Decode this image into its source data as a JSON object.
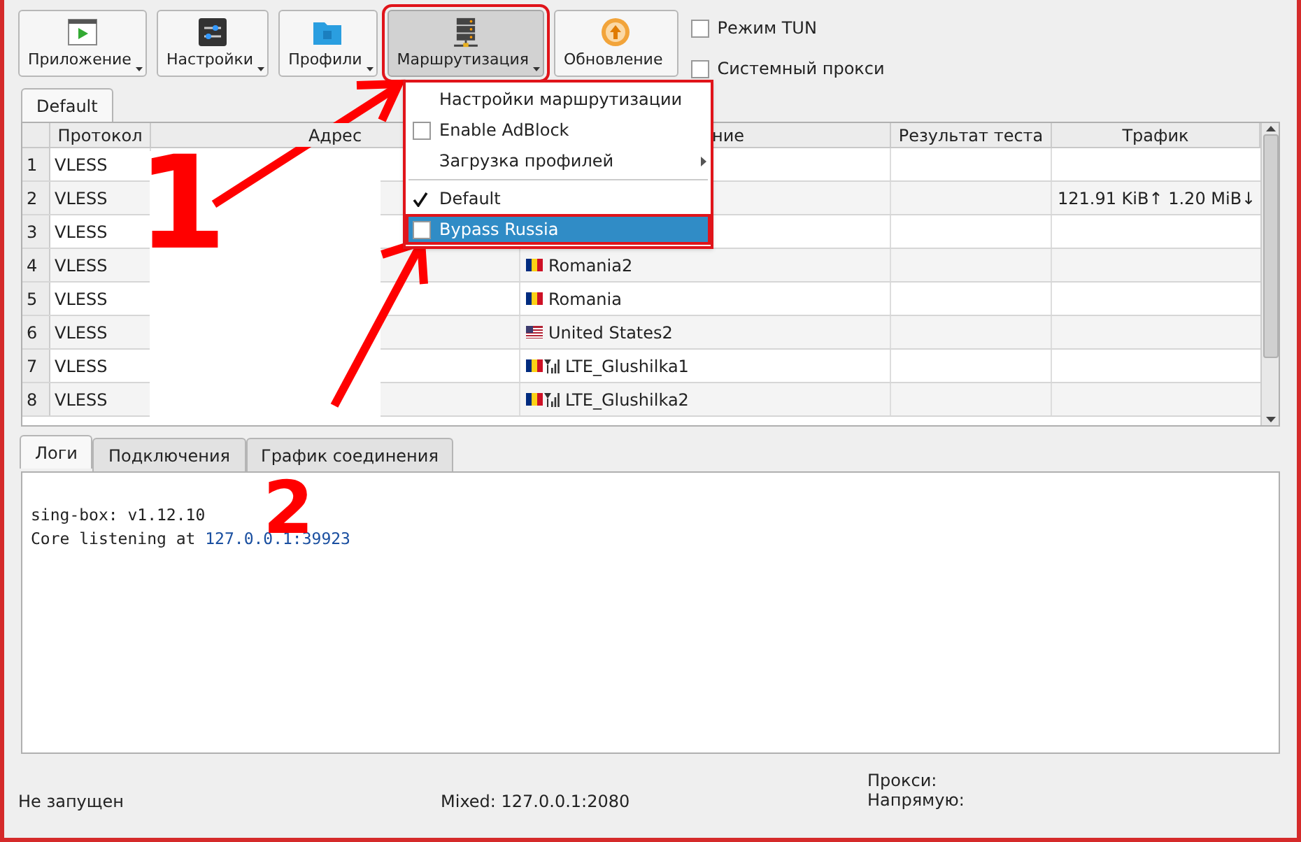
{
  "toolbar": {
    "buttons": [
      {
        "label": "Приложение",
        "kind": "app",
        "has_menu": true,
        "pressed": false
      },
      {
        "label": "Настройки",
        "kind": "settings",
        "has_menu": true,
        "pressed": false
      },
      {
        "label": "Профили",
        "kind": "profiles",
        "has_menu": true,
        "pressed": false
      },
      {
        "label": "Маршрутизация",
        "kind": "routing",
        "has_menu": true,
        "pressed": true
      },
      {
        "label": "Обновление",
        "kind": "update",
        "has_menu": false,
        "pressed": false
      }
    ],
    "checkboxes": [
      {
        "label": "Режим TUN",
        "checked": false
      },
      {
        "label": "Системный прокси",
        "checked": false
      }
    ]
  },
  "group_tabs": [
    {
      "label": "Default",
      "selected": true
    }
  ],
  "table": {
    "columns": [
      "Протокол",
      "Адрес",
      "ние",
      "Результат теста",
      "Трафик"
    ],
    "rows": [
      {
        "number": "1",
        "protocol": "VLESS",
        "kind": "plain"
      },
      {
        "number": "2",
        "protocol": "VLESS",
        "kind": "plain",
        "traffic": "121.91 KiB↑ 1.20 MiB↓"
      },
      {
        "number": "3",
        "protocol": "VLESS",
        "kind": "plain"
      },
      {
        "number": "4",
        "protocol": "VLESS",
        "name": "Romania2",
        "kind": "romania"
      },
      {
        "number": "5",
        "protocol": "VLESS",
        "name": "Romania",
        "kind": "romania"
      },
      {
        "number": "6",
        "protocol": "VLESS",
        "name": "United States2",
        "kind": "usa"
      },
      {
        "number": "7",
        "protocol": "VLESS",
        "name": "LTE_Glushilka1",
        "kind": "romania-lte"
      },
      {
        "number": "8",
        "protocol": "VLESS",
        "name": "LTE_Glushilka2",
        "kind": "romania-lte"
      }
    ]
  },
  "routing_menu": {
    "items": [
      {
        "kind": "action",
        "label": "Настройки маршрутизации",
        "selected": false
      },
      {
        "kind": "checkbox",
        "label": "Enable AdBlock",
        "checked": false,
        "selected": false
      },
      {
        "kind": "submenu",
        "label": "Загрузка профилей",
        "selected": false
      },
      {
        "kind": "separator"
      },
      {
        "kind": "checkbox",
        "label": "Default",
        "checked": true,
        "selected": false
      },
      {
        "kind": "checkbox",
        "label": "Bypass Russia",
        "checked": false,
        "selected": true
      }
    ]
  },
  "bottom_tabs": [
    {
      "label": "Логи",
      "selected": true
    },
    {
      "label": "Подключения",
      "selected": false
    },
    {
      "label": "График соединения",
      "selected": false
    }
  ],
  "log": {
    "lines": [
      {
        "text": "sing-box: v1.12.10"
      },
      {
        "text": "Core listening at ",
        "link": "127.0.0.1:39923"
      }
    ]
  },
  "status_bar": {
    "state": "Не запущен",
    "mixed": "Mixed: 127.0.0.1:2080",
    "proxy": "Прокси:",
    "direct": "Напрямую:"
  },
  "annotations": [
    {
      "label": "1"
    },
    {
      "label": "2"
    }
  ]
}
